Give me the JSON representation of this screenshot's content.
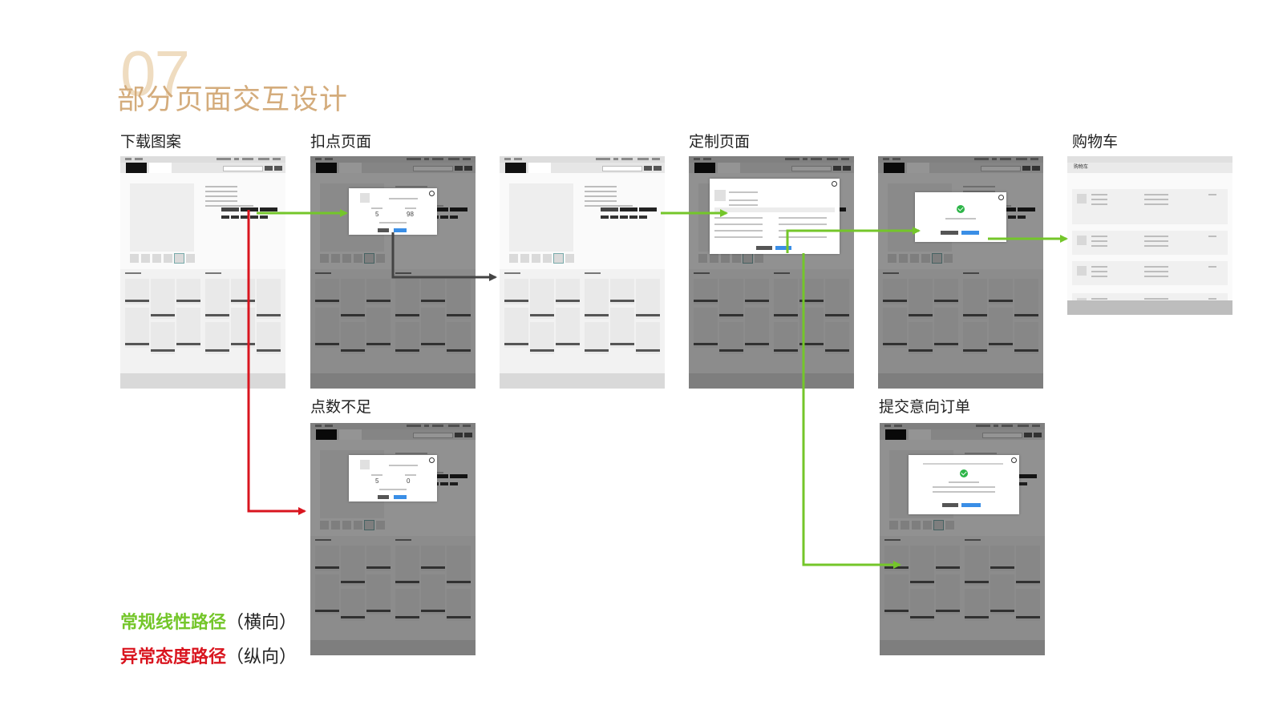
{
  "section": {
    "number": "07",
    "title": "部分页面交互设计"
  },
  "frames": [
    {
      "id": "download",
      "label": "下载图案",
      "overlay": false,
      "modal": "none"
    },
    {
      "id": "deduct",
      "label": "扣点页面",
      "overlay": true,
      "modal": "deduct",
      "numbers": [
        "5",
        "98"
      ]
    },
    {
      "id": "detail",
      "label": "",
      "overlay": false,
      "modal": "none"
    },
    {
      "id": "custom",
      "label": "定制页面",
      "overlay": true,
      "modal": "custom"
    },
    {
      "id": "added",
      "label": "",
      "overlay": true,
      "modal": "success"
    },
    {
      "id": "cart",
      "label": "购物车",
      "overlay": false,
      "modal": "cart",
      "cart_title": "购物车"
    },
    {
      "id": "insufficient",
      "label": "点数不足",
      "overlay": true,
      "modal": "deduct",
      "numbers": [
        "5",
        "0"
      ]
    },
    {
      "id": "submit",
      "label": "提交意向订单",
      "overlay": true,
      "modal": "submit"
    }
  ],
  "legend": {
    "normal": {
      "text": "常规线性路径",
      "note": "（横向）",
      "color": "#74c62a"
    },
    "abnormal": {
      "text": "异常态度路径",
      "note": "（纵向）",
      "color": "#d9151f"
    }
  },
  "colors": {
    "accent": "#d4ac7c",
    "green_path": "#74c62a",
    "red_path": "#d9151f",
    "dark_path": "#444444"
  }
}
